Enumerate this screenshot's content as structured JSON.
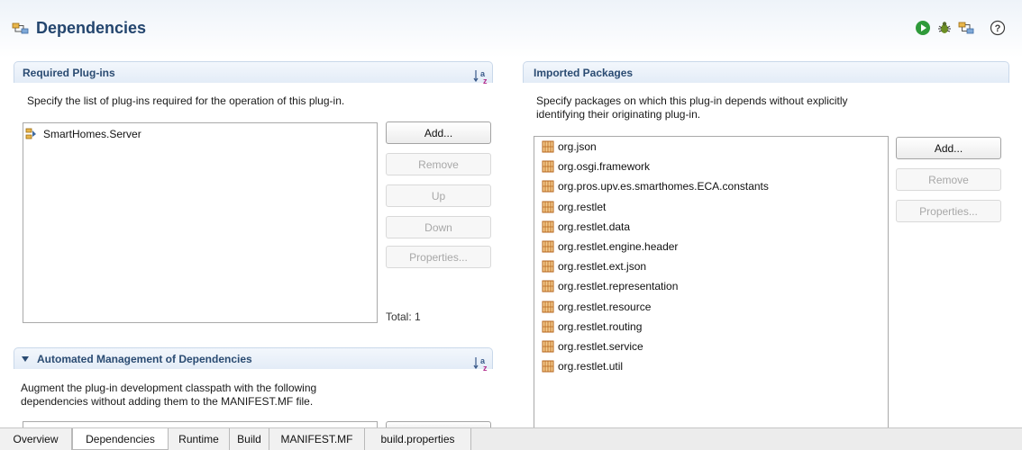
{
  "header": {
    "title": "Dependencies",
    "icon": "dependencies-icon"
  },
  "toolbar": {
    "run_icon": "run-icon",
    "debug_icon": "debug-icon",
    "export_icon": "export-icon",
    "help_icon": "help-icon"
  },
  "required": {
    "title": "Required Plug-ins",
    "description": "Specify the list of plug-ins required for the operation of this plug-in.",
    "items": [
      {
        "label": "SmartHomes.Server"
      }
    ],
    "buttons": {
      "add": "Add...",
      "remove": "Remove",
      "up": "Up",
      "down": "Down",
      "properties": "Properties..."
    },
    "total": "Total: 1"
  },
  "automated": {
    "title": "Automated Management of Dependencies",
    "description_line1": "Augment the plug-in development classpath with the following",
    "description_line2": "dependencies without adding them to the MANIFEST.MF file."
  },
  "imported": {
    "title": "Imported Packages",
    "description_line1": "Specify packages on which this plug-in depends without explicitly",
    "description_line2": "identifying their originating plug-in.",
    "packages": [
      "org.json",
      "org.osgi.framework",
      "org.pros.upv.es.smarthomes.ECA.constants",
      "org.restlet",
      "org.restlet.data",
      "org.restlet.engine.header",
      "org.restlet.ext.json",
      "org.restlet.representation",
      "org.restlet.resource",
      "org.restlet.routing",
      "org.restlet.service",
      "org.restlet.util"
    ],
    "buttons": {
      "add": "Add...",
      "remove": "Remove",
      "properties": "Properties..."
    }
  },
  "tabs": [
    {
      "label": "Overview"
    },
    {
      "label": "Dependencies",
      "active": true
    },
    {
      "label": "Runtime"
    },
    {
      "label": "Build"
    },
    {
      "label": "MANIFEST.MF"
    },
    {
      "label": "build.properties"
    }
  ],
  "colors": {
    "section_title": "#2a4b72",
    "header_title": "#23456e",
    "section_bar": "#e3ecf7",
    "package_icon": "#b5651d"
  }
}
